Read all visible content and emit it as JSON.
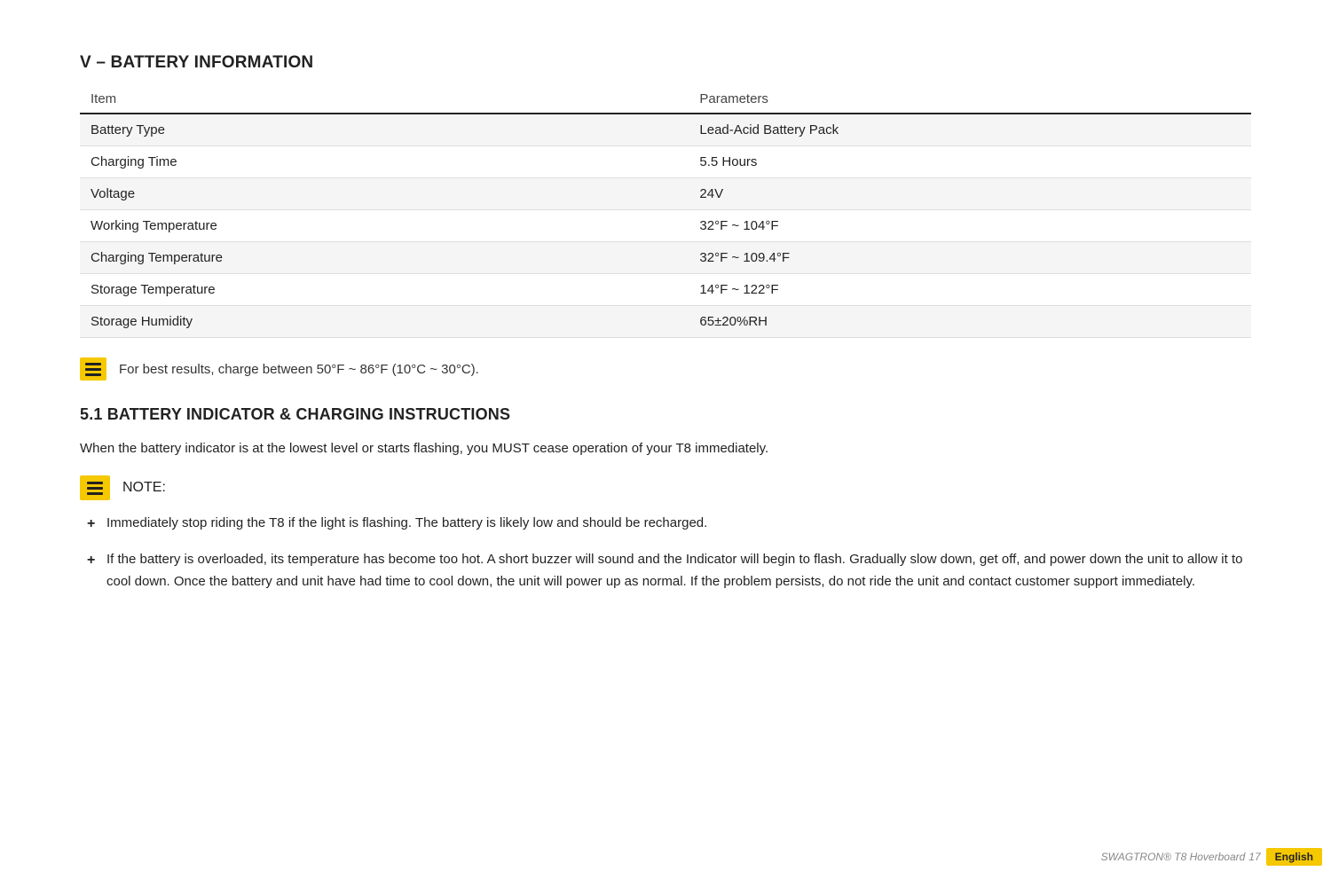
{
  "section": {
    "title": "V – BATTERY INFORMATION",
    "table": {
      "headers": [
        "Item",
        "Parameters"
      ],
      "rows": [
        [
          "Battery Type",
          "Lead-Acid Battery Pack"
        ],
        [
          "Charging Time",
          "5.5 Hours"
        ],
        [
          "Voltage",
          "24V"
        ],
        [
          "Working Temperature",
          "32°F ~ 104°F"
        ],
        [
          "Charging Temperature",
          "32°F ~ 109.4°F"
        ],
        [
          "Storage Temperature",
          "14°F ~ 122°F"
        ],
        [
          "Storage Humidity",
          "65±20%RH"
        ]
      ]
    },
    "best_results_note": "For best results, charge between  50°F ~ 86°F (10°C ~ 30°C).",
    "subsection": {
      "title": "5.1  BATTERY INDICATOR & CHARGING INSTRUCTIONS",
      "body": "When the battery indicator is at the lowest level or starts flashing, you MUST cease operation of your T8 immediately.",
      "note_label": "NOTE:",
      "bullets": [
        "Immediately stop riding the T8 if the light is flashing. The battery is likely low and should be recharged.",
        "If the battery is overloaded, its temperature has become too hot. A short buzzer will sound and the Indicator will begin to flash. Gradually slow down, get off, and power down the unit to allow it to cool down. Once the battery and unit have had time to cool down, the unit will power up as normal. If the problem persists, do not ride the unit and contact customer support immediately."
      ]
    }
  },
  "footer": {
    "brand": "SWAGTRON® T8 Hoverboard",
    "page": "17",
    "language": "English"
  }
}
